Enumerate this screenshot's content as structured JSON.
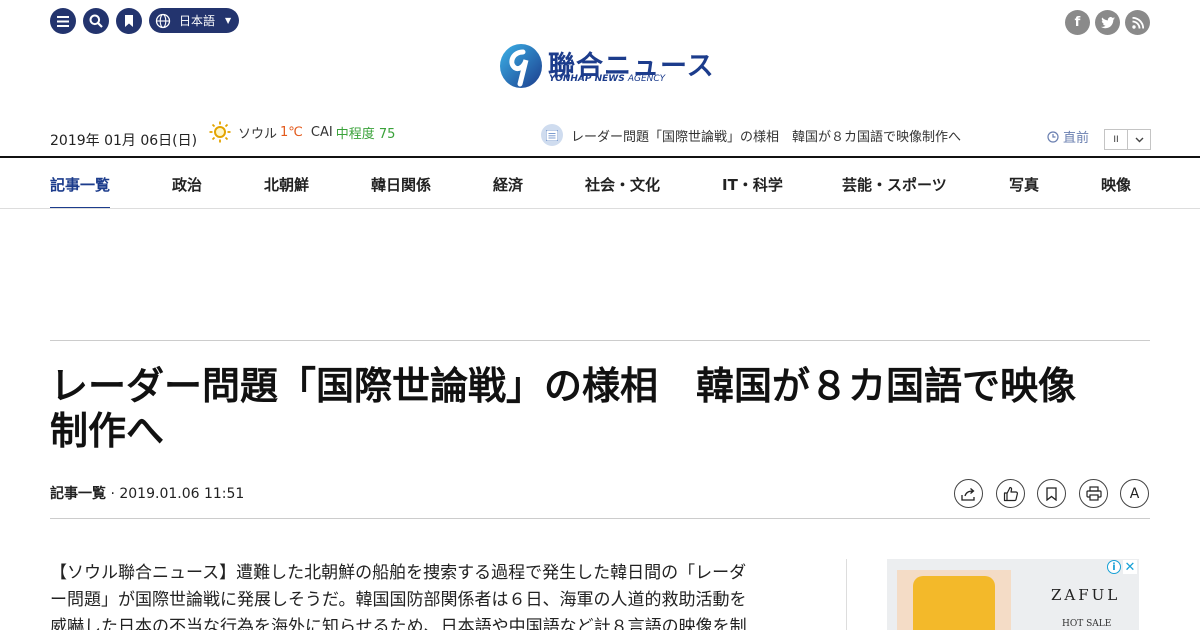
{
  "top_bar": {
    "language_label": "日本語",
    "social": [
      "f",
      "t",
      "rss"
    ]
  },
  "logo": {
    "japanese": "聯合ニュース",
    "english_bold": "YONHAP NEWS",
    "english_light": "AGENCY"
  },
  "info_bar": {
    "date": "2019年 01月 06日(日)",
    "weather_city": "ソウル",
    "weather_temp": "1℃",
    "cai_label": "CAI",
    "cai_value": "中程度 75",
    "ticker_headline": "レーダー問題「国際世論戦」の様相　韓国が８カ国語で映像制作へ",
    "latest_label": "直前",
    "pause_label": "II"
  },
  "nav": {
    "items": [
      "記事一覧",
      "政治",
      "北朝鮮",
      "韓日関係",
      "経済",
      "社会・文化",
      "IT・科学",
      "芸能・スポーツ",
      "写真",
      "映像"
    ]
  },
  "article": {
    "headline_line1": "レーダー問題「国際世論戦」の様相　韓国が８カ国語で映像",
    "headline_line2": "制作へ",
    "category": "記事一覧",
    "separator": " · ",
    "timestamp": "2019.01.06 11:51",
    "font_button": "A",
    "body_line1": "【ソウル聯合ニュース】遭難した北朝鮮の船舶を捜索する過程で発生した韓日間の「レーダ",
    "body_line2": "ー問題」が国際世論戦に発展しそうだ。韓国国防部関係者は６日、海軍の人道的救助活動を",
    "body_line3": "威嚇した日本の不当な行為を海外に知らせるため、日本語や中国語など計８言語の映像を制"
  },
  "ad": {
    "brand": "ZAFUL",
    "sale_text": "HOT SALE",
    "colors": {
      "swimsuit": "#f3b92a",
      "background": "#eceef0"
    }
  },
  "colors": {
    "brand_navy": "#23346e",
    "logo_blue": "#1c3c8c",
    "temp_orange": "#e35a1c",
    "cai_green": "#3aa23a"
  }
}
